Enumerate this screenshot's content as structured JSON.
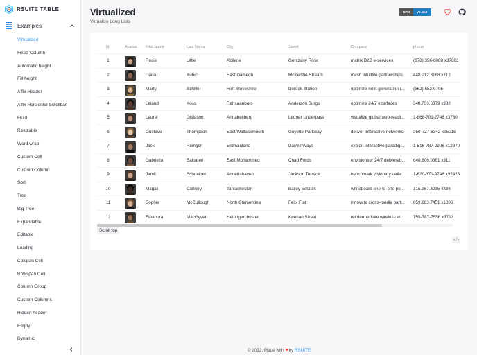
{
  "sidebar": {
    "brand": "RSUITE TABLE",
    "group_label": "Examples",
    "items": [
      {
        "label": "Virtualized",
        "active": true
      },
      {
        "label": "Fixed Column"
      },
      {
        "label": "Automatic height"
      },
      {
        "label": "Fill height"
      },
      {
        "label": "Affix Header"
      },
      {
        "label": "Affix Horizontal Scrollbar"
      },
      {
        "label": "Fluid"
      },
      {
        "label": "Resizable"
      },
      {
        "label": "Word wrap"
      },
      {
        "label": "Custom Cell"
      },
      {
        "label": "Custom Column"
      },
      {
        "label": "Sort"
      },
      {
        "label": "Tree"
      },
      {
        "label": "Big Tree"
      },
      {
        "label": "Expandable"
      },
      {
        "label": "Editable"
      },
      {
        "label": "Loading"
      },
      {
        "label": "Colspan Cell"
      },
      {
        "label": "Rowspan Cell"
      },
      {
        "label": "Column Group"
      },
      {
        "label": "Custom Columns"
      },
      {
        "label": "Hidden header"
      },
      {
        "label": "Empty"
      },
      {
        "label": "Dynamic"
      }
    ]
  },
  "header": {
    "title": "Virtualized",
    "subtitle": "Virtualize Long Lists",
    "npm_key": "NPM",
    "npm_version": "V5.10.2"
  },
  "table": {
    "columns": [
      "Id",
      "Avartar",
      "First Name",
      "Last Name",
      "City",
      "Street",
      "Company",
      "phone"
    ],
    "rows": [
      {
        "id": "1",
        "first": "Rosie",
        "last": "Little",
        "city": "Abilene",
        "street": "Gorczany River",
        "company": "matrix B2B e-services",
        "phone": "(878) 356-6088 x37863"
      },
      {
        "id": "2",
        "first": "Dario",
        "last": "Kuhic",
        "city": "East Dameon",
        "street": "McKenzie Stream",
        "company": "mesh intuitive partnerships",
        "phone": "448.212.3188 x712"
      },
      {
        "id": "3",
        "first": "Marty",
        "last": "Schiller",
        "city": "Fort Steveshire",
        "street": "Dereck Station",
        "company": "optimize next-generation r...",
        "phone": "(562) 652-9705"
      },
      {
        "id": "4",
        "first": "Leland",
        "last": "Koss",
        "city": "Rahsaanboro",
        "street": "Anderson Burgs",
        "company": "optimize 24/7 interfaces",
        "phone": "348.730.6379 x982"
      },
      {
        "id": "5",
        "first": "Laurel",
        "last": "Gislason",
        "city": "Annabellberg",
        "street": "Ledner Underpass",
        "company": "visualize global web-readi...",
        "phone": "1-868-701-2748 x3730"
      },
      {
        "id": "6",
        "first": "Gustave",
        "last": "Thompson",
        "city": "East Wallacemouth",
        "street": "Goyette Parkway",
        "company": "deliver interactive networks",
        "phone": "350-727-8342 x95015"
      },
      {
        "id": "7",
        "first": "Jack",
        "last": "Reinger",
        "city": "Erdmanland",
        "street": "Darrell Ways",
        "company": "exploit interactive paradig...",
        "phone": "1-516-787-2906 x12870"
      },
      {
        "id": "8",
        "first": "Gabriella",
        "last": "Balistreri",
        "city": "East Mohammed",
        "street": "Chad Fords",
        "company": "envisioneer 24/7 deliverab...",
        "phone": "648.806.9381 x311"
      },
      {
        "id": "9",
        "first": "Jamil",
        "last": "Schneider",
        "city": "Annettahaven",
        "street": "Jackson Terrace",
        "company": "benchmark visionary deliv...",
        "phone": "1-620-371-9748 x97428"
      },
      {
        "id": "10",
        "first": "Magali",
        "last": "Corkery",
        "city": "Taniachester",
        "street": "Bailey Estates",
        "company": "whiteboard one-to-one po...",
        "phone": "315.957.3235 x336"
      },
      {
        "id": "11",
        "first": "Sophie",
        "last": "McCullough",
        "city": "North Clementina",
        "street": "Felix Flat",
        "company": "innovate cross-media part...",
        "phone": "859.283.7451 x1086"
      },
      {
        "id": "12",
        "first": "Eleanora",
        "last": "MacGyver",
        "city": "Hettingerchester",
        "street": "Keenan Street",
        "company": "reintermediate wireless w...",
        "phone": "759-787-7556 x3713"
      }
    ],
    "scroll_top_label": "Scroll top",
    "code_icon_label": "</>",
    "horizontal_scroll_fraction": 0.8
  },
  "footer": {
    "prefix": "© 2022, Made with",
    "by": "by",
    "link": "RSUITE"
  },
  "colors": {
    "accent": "#3498ff",
    "heart": "#f44336",
    "npm_version_bg": "#1e7dc3"
  },
  "icons": {
    "brand": "rsuite-logo-icon",
    "group": "grid-icon",
    "chevron": "chevron-up-icon",
    "collapse": "chevron-left-icon",
    "heart": "heart-icon",
    "github": "github-icon",
    "code": "code-icon"
  }
}
